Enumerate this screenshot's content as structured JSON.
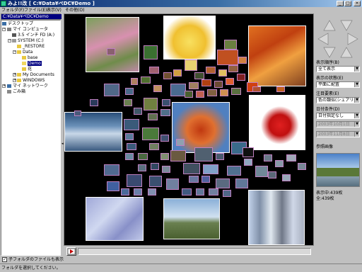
{
  "window": {
    "title": "みよ!!改 [ C:¥Data¥ペDC¥Demo ]",
    "buttons": [
      "_",
      "□",
      "×"
    ]
  },
  "menu": [
    "フォルダ(F)",
    "ファイル(E)",
    "表示(V)",
    "その他(O)"
  ],
  "path": "C:¥Data¥ペDC¥Demo",
  "tree": [
    {
      "label": "デスクトップ",
      "indent": 0,
      "icon": "desktop-icon",
      "selected": false
    },
    {
      "label": "マイ コンピュータ",
      "indent": 1,
      "icon": "computer-icon",
      "selected": false
    },
    {
      "label": "3.5 インチ FD (A:)",
      "indent": 2,
      "icon": "floppy-icon",
      "selected": false
    },
    {
      "label": "SYSTEM (C:)",
      "indent": 2,
      "icon": "drive-icon",
      "selected": false
    },
    {
      "label": "_RESTORE",
      "indent": 3,
      "icon": "folder-icon",
      "selected": false
    },
    {
      "label": "Data",
      "indent": 3,
      "icon": "folder-icon",
      "selected": false
    },
    {
      "label": "base",
      "indent": 4,
      "icon": "folder-icon",
      "selected": false
    },
    {
      "label": "Demo",
      "indent": 4,
      "icon": "folder-open-icon",
      "selected": true
    },
    {
      "label": "花",
      "indent": 4,
      "icon": "folder-icon",
      "selected": false
    },
    {
      "label": "My Documents",
      "indent": 3,
      "icon": "folder-icon",
      "selected": false
    },
    {
      "label": "WINDOWS",
      "indent": 3,
      "icon": "folder-icon",
      "selected": false
    },
    {
      "label": "マイ ネットワーク",
      "indent": 0,
      "icon": "network-icon",
      "selected": false
    },
    {
      "label": "ごみ箱",
      "indent": 0,
      "icon": "recycle-bin-icon",
      "selected": false
    }
  ],
  "right": {
    "display_order_label": "表示順序(B)",
    "display_order_value": "全て表示",
    "display_state_label": "表示の状態(E)",
    "display_state_value": "平面に配置",
    "attention_label": "注目要素(E)",
    "attention_value": "色の類似(シェアリ)",
    "date_label": "日付条件(D)",
    "date_value": "日付指定なし",
    "date_from": "2003年10月1日",
    "date_to": "2003年11月8日",
    "reference_label": "参照画像",
    "count_shown": "表示中:439枚",
    "count_total": "全:439枚"
  },
  "checkbox_label": "子フォルダのファイルも表示",
  "checkbox_checked": true,
  "status": "フォルダを選択してください。"
}
